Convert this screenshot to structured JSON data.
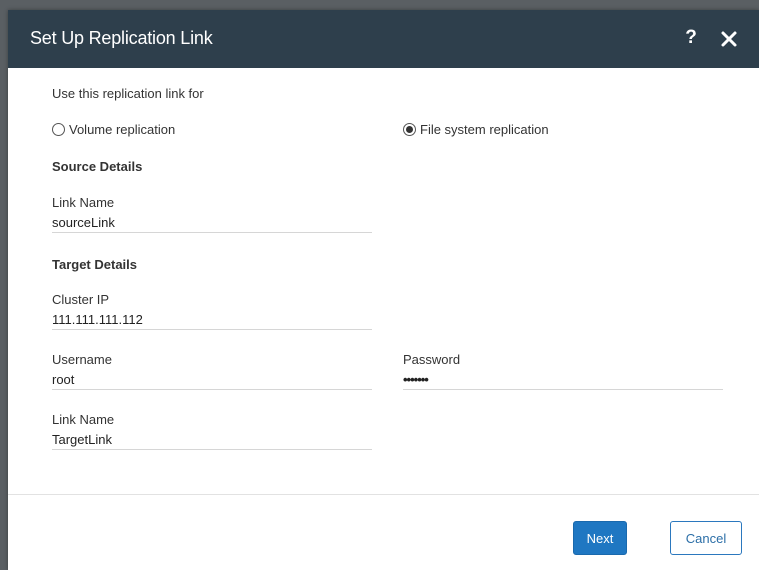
{
  "dialog": {
    "title": "Set Up Replication Link",
    "help_label": "?",
    "close_icon": "close-icon"
  },
  "replication": {
    "use_label": "Use this replication link for",
    "options": [
      {
        "label": "Volume replication",
        "selected": false
      },
      {
        "label": "File system replication",
        "selected": true
      }
    ]
  },
  "source": {
    "heading": "Source Details",
    "link_name_label": "Link Name",
    "link_name_value": "sourceLink"
  },
  "target": {
    "heading": "Target Details",
    "cluster_ip_label": "Cluster IP",
    "cluster_ip_value": "111.111.111.112",
    "username_label": "Username",
    "username_value": "root",
    "password_label": "Password",
    "password_value": "•••••••",
    "link_name_label": "Link Name",
    "link_name_value": "TargetLink"
  },
  "footer": {
    "next_label": "Next",
    "cancel_label": "Cancel"
  },
  "colors": {
    "titlebar": "#2e3f4c",
    "primary": "#1f77c2"
  }
}
